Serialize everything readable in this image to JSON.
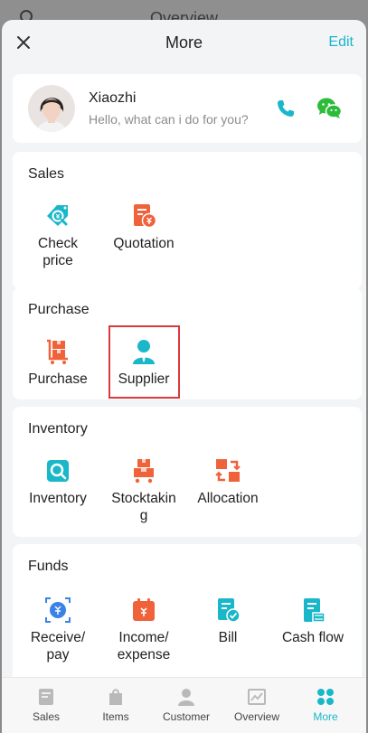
{
  "background": {
    "title": "Overview"
  },
  "header": {
    "title": "More",
    "edit_label": "Edit"
  },
  "assistant": {
    "name": "Xiaozhi",
    "greeting": "Hello, what can i do for you?"
  },
  "sections": {
    "sales": {
      "title": "Sales",
      "items": [
        {
          "label": "Check\nprice",
          "icon": "check-price-icon"
        },
        {
          "label": "Quotation",
          "icon": "quotation-icon"
        }
      ]
    },
    "purchase": {
      "title": "Purchase",
      "items": [
        {
          "label": "Purchase",
          "icon": "purchase-cart-icon"
        },
        {
          "label": "Supplier",
          "icon": "supplier-icon"
        }
      ]
    },
    "inventory": {
      "title": "Inventory",
      "items": [
        {
          "label": "Inventory",
          "icon": "inventory-search-icon"
        },
        {
          "label": "Stocktakin\ng",
          "icon": "stocktaking-icon"
        },
        {
          "label": "Allocation",
          "icon": "allocation-icon"
        }
      ]
    },
    "funds": {
      "title": "Funds",
      "items": [
        {
          "label": "Receive/\npay",
          "icon": "receive-pay-icon"
        },
        {
          "label": "Income/\nexpense",
          "icon": "income-expense-icon"
        },
        {
          "label": "Bill",
          "icon": "bill-icon"
        },
        {
          "label": "Cash flow",
          "icon": "cash-flow-icon"
        }
      ]
    }
  },
  "tabs": [
    {
      "label": "Sales",
      "icon": "sales-tab-icon"
    },
    {
      "label": "Items",
      "icon": "items-tab-icon"
    },
    {
      "label": "Customer",
      "icon": "customer-tab-icon"
    },
    {
      "label": "Overview",
      "icon": "overview-tab-icon"
    },
    {
      "label": "More",
      "icon": "more-tab-icon",
      "active": true
    }
  ],
  "colors": {
    "accent": "#19b7c9",
    "orange": "#f0623a",
    "highlight": "#d93a3a"
  }
}
